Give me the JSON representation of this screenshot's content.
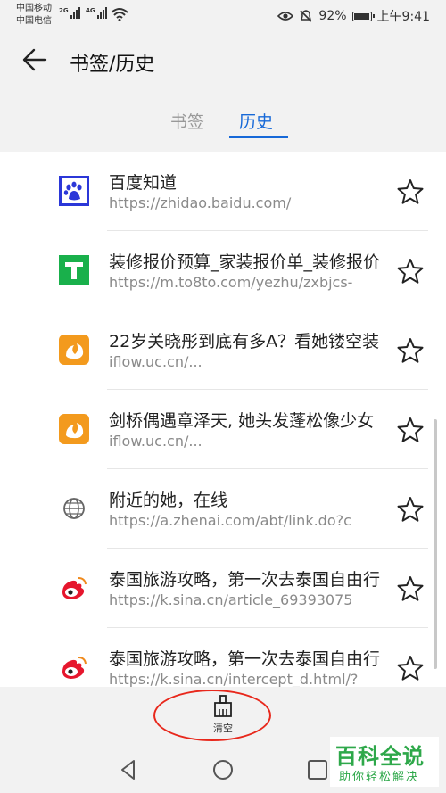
{
  "status_bar": {
    "carrier1": "中国移动",
    "carrier2": "中国电信",
    "net1": "2G",
    "net2": "4G",
    "battery": "92%",
    "time": "上午9:41"
  },
  "header": {
    "title": "书签/历史"
  },
  "tabs": [
    {
      "label": "书签",
      "active": false
    },
    {
      "label": "历史",
      "active": true
    }
  ],
  "history": [
    {
      "title": "百度知道",
      "url": "https://zhidao.baidu.com/",
      "icon": "baidu-paw-icon"
    },
    {
      "title": "装修报价预算_家装报价单_装修报价",
      "url": "https://m.to8to.com/yezhu/zxbjcs-",
      "icon": "to8to-icon"
    },
    {
      "title": "22岁关晓彤到底有多A？看她镂空装",
      "url": "iflow.uc.cn/...",
      "icon": "uc-squirrel-icon"
    },
    {
      "title": "剑桥偶遇章泽天, 她头发蓬松像少女",
      "url": "iflow.uc.cn/...",
      "icon": "uc-squirrel-icon"
    },
    {
      "title": "附近的她，在线",
      "url": "https://a.zhenai.com/abt/link.do?c",
      "icon": "globe-icon"
    },
    {
      "title": "泰国旅游攻略，第一次去泰国自由行",
      "url": "https://k.sina.cn/article_69393075",
      "icon": "weibo-icon"
    },
    {
      "title": "泰国旅游攻略，第一次去泰国自由行",
      "url": "https://k.sina.cn/intercept_d.html/?",
      "icon": "weibo-icon"
    }
  ],
  "toolbar": {
    "clear_label": "清空"
  },
  "watermark": {
    "big": "百科全说",
    "small": "助你轻松解决"
  },
  "colors": {
    "accent": "#1769d8",
    "annotation": "#e8281c",
    "watermark": "#2ea84a"
  }
}
